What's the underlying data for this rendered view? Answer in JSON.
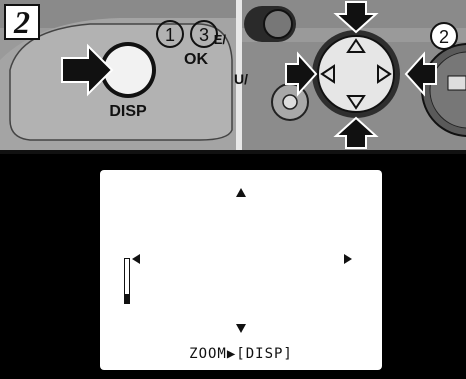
{
  "step_number": "2",
  "camera": {
    "disp_label": "DISP",
    "ok_label": "OK",
    "menu_partial_label": "E/",
    "u_partial_label": "U/",
    "callout_1": "1",
    "callout_2": "2",
    "callout_3": "3"
  },
  "lcd": {
    "zoom_text": "ZOOM▶[DISP]",
    "zoom_level": 0.2
  },
  "colors": {
    "photo_bg": "#9a9a9a",
    "body_dark": "#6e6e6e",
    "ink": "#111111",
    "lcd_bg": "#000000",
    "lcd_screen": "#ffffff"
  }
}
